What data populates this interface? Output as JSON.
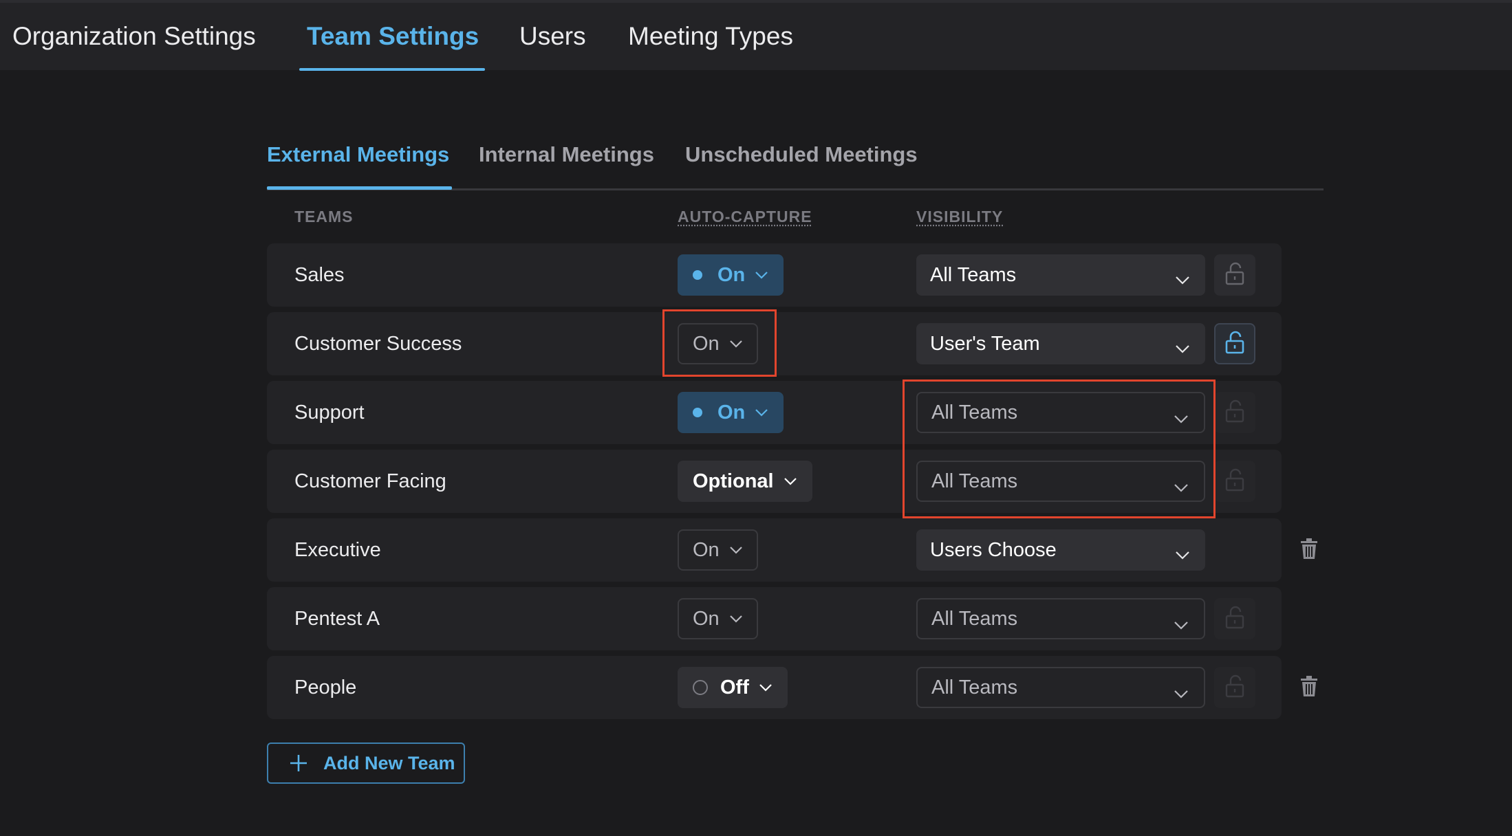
{
  "top_tabs": [
    {
      "label": "Organization Settings",
      "active": false
    },
    {
      "label": "Team Settings",
      "active": true
    },
    {
      "label": "Users",
      "active": false
    },
    {
      "label": "Meeting Types",
      "active": false
    }
  ],
  "sub_tabs": [
    {
      "label": "External Meetings",
      "active": true
    },
    {
      "label": "Internal Meetings",
      "active": false
    },
    {
      "label": "Unscheduled Meetings",
      "active": false
    }
  ],
  "columns": {
    "teams": "TEAMS",
    "auto_capture": "AUTO-CAPTURE",
    "visibility": "VISIBILITY"
  },
  "rows": [
    {
      "team": "Sales",
      "auto_capture": "On",
      "visibility": "All Teams"
    },
    {
      "team": "Customer Success",
      "auto_capture": "On",
      "visibility": "User's Team"
    },
    {
      "team": "Support",
      "auto_capture": "On",
      "visibility": "All Teams"
    },
    {
      "team": "Customer Facing",
      "auto_capture": "Optional",
      "visibility": "All Teams"
    },
    {
      "team": "Executive",
      "auto_capture": "On",
      "visibility": "Users Choose"
    },
    {
      "team": "Pentest A",
      "auto_capture": "On",
      "visibility": "All Teams"
    },
    {
      "team": "People",
      "auto_capture": "Off",
      "visibility": "All Teams"
    }
  ],
  "add_button": {
    "label": "Add New Team"
  },
  "colors": {
    "accent": "#5ab4ea",
    "highlight": "#e2452d",
    "background": "#1b1b1d",
    "row": "#232326"
  }
}
